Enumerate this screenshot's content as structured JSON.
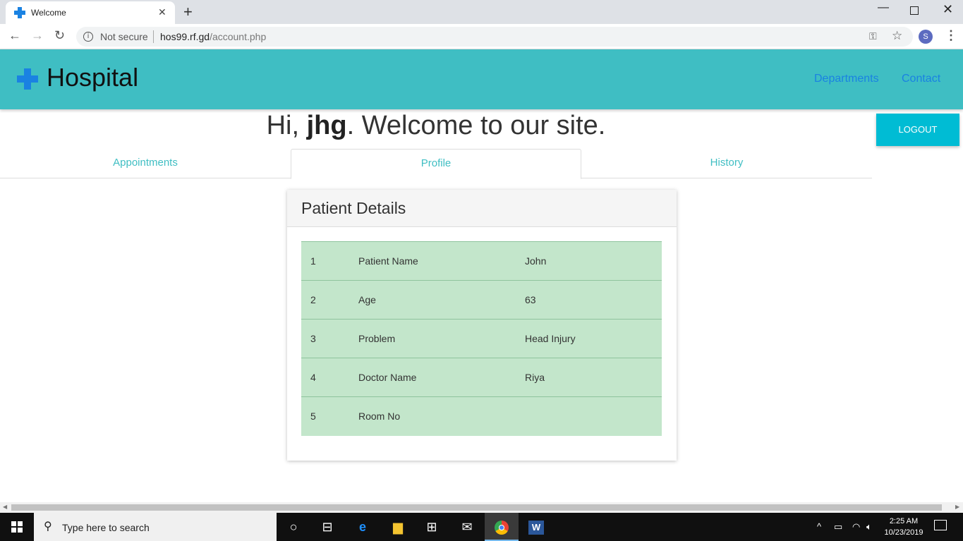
{
  "browser": {
    "tab_title": "Welcome",
    "new_tab": "+",
    "not_secure": "Not secure",
    "url_host": "hos99.rf.gd",
    "url_path": "/account.php",
    "profile_initial": "S"
  },
  "header": {
    "brand": "Hospital",
    "nav": [
      "Departments",
      "Contact"
    ]
  },
  "greeting": {
    "prefix": "Hi, ",
    "username": "jhg",
    "suffix": ". Welcome to our site."
  },
  "logout_label": "LOGOUT",
  "tabs": [
    "Appointments",
    "Profile",
    "History"
  ],
  "active_tab": "Profile",
  "panel": {
    "title": "Patient Details",
    "rows": [
      {
        "num": "1",
        "label": "Patient Name",
        "value": "John"
      },
      {
        "num": "2",
        "label": "Age",
        "value": "63"
      },
      {
        "num": "3",
        "label": "Problem",
        "value": "Head Injury"
      },
      {
        "num": "4",
        "label": "Doctor Name",
        "value": "Riya"
      },
      {
        "num": "5",
        "label": "Room No",
        "value": ""
      }
    ]
  },
  "colors": {
    "header": "#3fbec3",
    "accent_link": "#1a82e2",
    "logout": "#00bcd4",
    "row_bg": "#c3e6cb"
  },
  "taskbar": {
    "search_placeholder": "Type here to search",
    "time": "2:25 AM",
    "date": "10/23/2019"
  }
}
